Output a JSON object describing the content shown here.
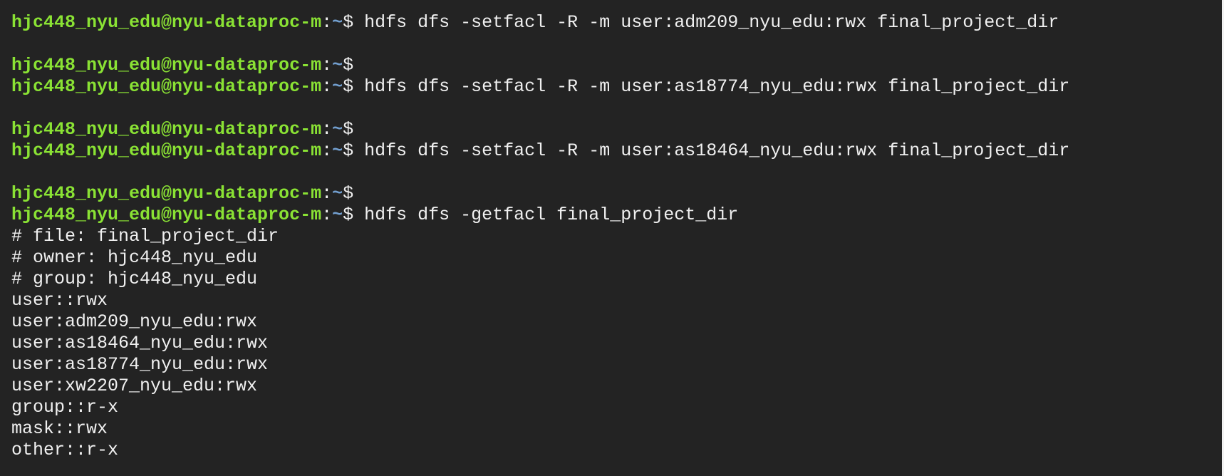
{
  "prompt": {
    "user_host": "hjc448_nyu_edu@nyu-dataproc-m",
    "separator": ":",
    "path": "~",
    "symbol": "$"
  },
  "commands": {
    "setfacl_adm": "hdfs dfs -setfacl -R -m user:adm209_nyu_edu:rwx final_project_dir",
    "setfacl_as18774": "hdfs dfs -setfacl -R -m user:as18774_nyu_edu:rwx final_project_dir",
    "setfacl_as18464": "hdfs dfs -setfacl -R -m user:as18464_nyu_edu:rwx final_project_dir",
    "getfacl": "hdfs dfs -getfacl final_project_dir"
  },
  "output": [
    "# file: final_project_dir",
    "# owner: hjc448_nyu_edu",
    "# group: hjc448_nyu_edu",
    "user::rwx",
    "user:adm209_nyu_edu:rwx",
    "user:as18464_nyu_edu:rwx",
    "user:as18774_nyu_edu:rwx",
    "user:xw2207_nyu_edu:rwx",
    "group::r-x",
    "mask::rwx",
    "other::r-x"
  ],
  "colors": {
    "background": "#232323",
    "prompt_user": "#8ae234",
    "prompt_path": "#729fcf",
    "text": "#f0f0f0"
  }
}
